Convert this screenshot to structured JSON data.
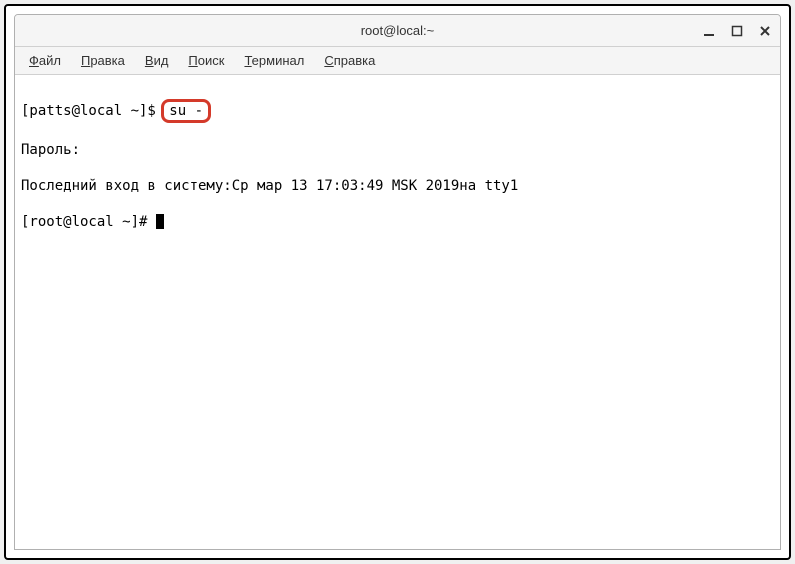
{
  "window": {
    "title": "root@local:~"
  },
  "menubar": {
    "items": [
      {
        "label": "Файл",
        "accel": "Ф"
      },
      {
        "label": "Правка",
        "accel": "П"
      },
      {
        "label": "Вид",
        "accel": "В"
      },
      {
        "label": "Поиск",
        "accel": "П"
      },
      {
        "label": "Терминал",
        "accel": "Т"
      },
      {
        "label": "Справка",
        "accel": "С"
      }
    ]
  },
  "terminal": {
    "line1_prompt": "[patts@local ~]$ ",
    "line1_cmd": "su -",
    "line2": "Пароль:",
    "line3": "Последний вход в систему:Ср мар 13 17:03:49 MSK 2019на tty1",
    "line4_prompt": "[root@local ~]# "
  }
}
